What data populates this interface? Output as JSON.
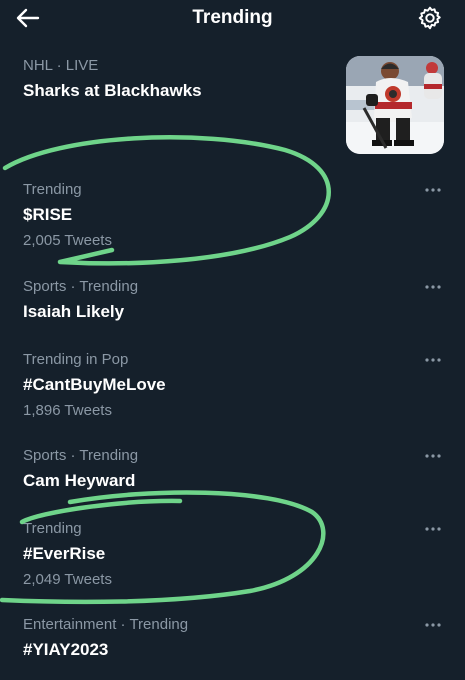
{
  "header": {
    "title": "Trending",
    "back_icon": "arrow-left-icon",
    "settings_icon": "gear-icon"
  },
  "trends": [
    {
      "meta": "NHL · LIVE",
      "name": "Sharks at Blackhawks",
      "thumbnail": "hockey-players-image"
    },
    {
      "meta": "Trending",
      "name": "$RISE",
      "count": "2,005 Tweets"
    },
    {
      "meta": "Sports · Trending",
      "name": "Isaiah Likely"
    },
    {
      "meta": "Trending in Pop",
      "name": "#CantBuyMeLove",
      "count": "1,896 Tweets"
    },
    {
      "meta": "Sports · Trending",
      "name": "Cam Heyward"
    },
    {
      "meta": "Trending",
      "name": "#EverRise",
      "count": "2,049 Tweets"
    },
    {
      "meta": "Entertainment · Trending",
      "name": "#YIAY2023"
    }
  ],
  "colors": {
    "background": "#15202b",
    "primary_text": "#ffffff",
    "secondary_text": "#8b98a5",
    "annotation_green": "#6fd48a"
  }
}
